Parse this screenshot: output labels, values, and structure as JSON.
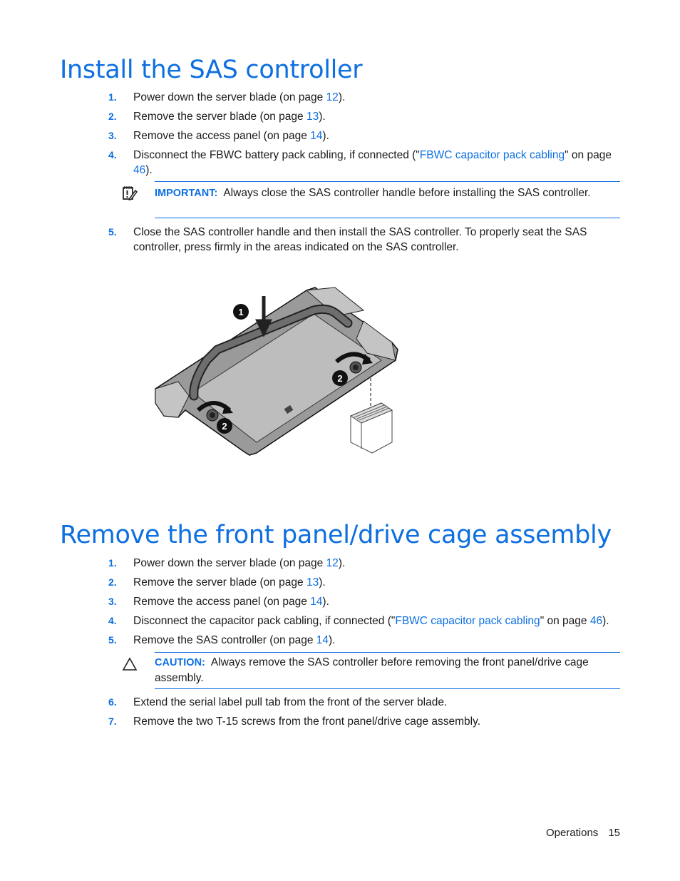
{
  "section1": {
    "title": "Install the SAS controller",
    "steps": [
      {
        "num": "1.",
        "pre": "Power down the server blade (on page ",
        "link": "12",
        "post": ")."
      },
      {
        "num": "2.",
        "pre": "Remove the server blade (on page ",
        "link": "13",
        "post": ")."
      },
      {
        "num": "3.",
        "pre": "Remove the access panel (on page ",
        "link": "14",
        "post": ")."
      },
      {
        "num": "4.",
        "pre": "Disconnect the FBWC battery pack cabling, if connected (\"",
        "link": "FBWC capacitor pack cabling",
        "mid": "\" on page ",
        "link2": "46",
        "post": ")."
      }
    ],
    "important": {
      "icon": "important-notepad-icon",
      "label": "IMPORTANT:",
      "text": "Always close the SAS controller handle before installing the SAS controller."
    },
    "step5": {
      "num": "5.",
      "text": "Close the SAS controller handle and then install the SAS controller. To properly seat the SAS controller, press firmly in the areas indicated on the SAS controller."
    },
    "figure": {
      "description": "SAS controller installation illustration",
      "callouts": [
        "1",
        "2",
        "2"
      ]
    }
  },
  "section2": {
    "title": "Remove the front panel/drive cage assembly",
    "steps": [
      {
        "num": "1.",
        "pre": "Power down the server blade (on page ",
        "link": "12",
        "post": ")."
      },
      {
        "num": "2.",
        "pre": "Remove the server blade (on page ",
        "link": "13",
        "post": ")."
      },
      {
        "num": "3.",
        "pre": "Remove the access panel (on page ",
        "link": "14",
        "post": ")."
      },
      {
        "num": "4.",
        "pre": "Disconnect the capacitor pack cabling, if connected (\"",
        "link": "FBWC capacitor pack cabling",
        "mid": "\" on page ",
        "link2": "46",
        "post": ")."
      },
      {
        "num": "5.",
        "pre": "Remove the SAS controller (on page ",
        "link": "14",
        "post": ")."
      }
    ],
    "caution": {
      "icon": "caution-triangle-icon",
      "label": "CAUTION:",
      "text": "Always remove the SAS controller before removing the front panel/drive cage assembly."
    },
    "steps_after": [
      {
        "num": "6.",
        "text": "Extend the serial label pull tab from the front of the server blade."
      },
      {
        "num": "7.",
        "text": "Remove the two T-15 screws from the front panel/drive cage assembly."
      }
    ]
  },
  "footer": {
    "section": "Operations",
    "page": "15"
  },
  "colors": {
    "accent": "#0d6fe0",
    "text": "#1a1a1a"
  }
}
